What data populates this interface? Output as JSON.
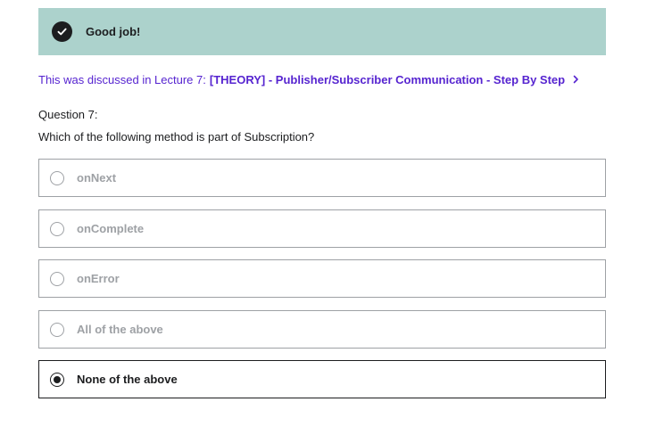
{
  "feedback": {
    "icon": "check-circle-icon",
    "message": "Good job!",
    "background_color": "#acd2cc"
  },
  "lecture_reference": {
    "prefix": "This was discussed in Lecture 7:",
    "link_text": "[THEORY] - Publisher/Subscriber Communication - Step By Step",
    "link_icon": "chevron-right-icon",
    "link_color": "#5624d0"
  },
  "question": {
    "label": "Question 7:",
    "text": "Which of the following method is part of Subscription?",
    "options": [
      {
        "label": "onNext",
        "selected": false
      },
      {
        "label": "onComplete",
        "selected": false
      },
      {
        "label": "onError",
        "selected": false
      },
      {
        "label": "All of the above",
        "selected": false
      },
      {
        "label": "None of the above",
        "selected": true
      }
    ]
  }
}
